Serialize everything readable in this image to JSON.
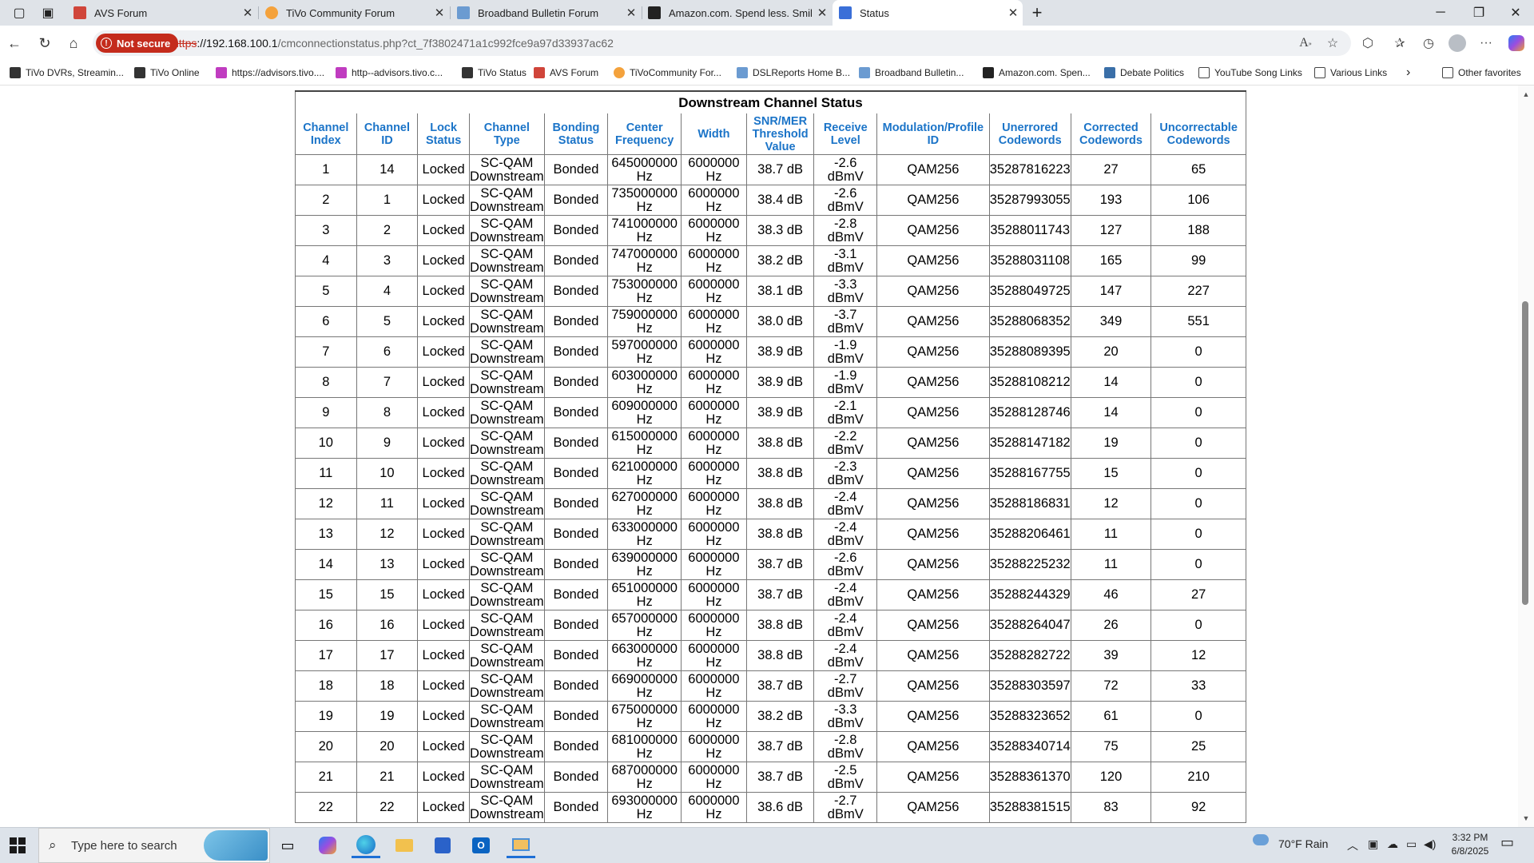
{
  "browser": {
    "tabs": [
      {
        "title": "AVS Forum",
        "favicon_color": "#d0453a",
        "active": false
      },
      {
        "title": "TiVo Community Forum",
        "favicon_color": "#f4a23c",
        "active": false
      },
      {
        "title": "Broadband Bulletin Forum",
        "favicon_color": "#6b9bd1",
        "active": false
      },
      {
        "title": "Amazon.com. Spend less. Smile more.",
        "favicon_color": "#222222",
        "active": false
      },
      {
        "title": "Status",
        "favicon_color": "#3a6fd8",
        "active": true
      }
    ],
    "close_glyph": "✕",
    "new_tab_glyph": "+",
    "window_controls": {
      "minimize": "─",
      "restore": "❐",
      "close": "✕"
    },
    "security_label": "Not secure",
    "url_protocol": "https",
    "url_host": "://192.168.100.1",
    "url_path": "/cmconnectionstatus.php?ct_7f3802471a1c992fce9a97d33937ac62",
    "bookmarks": [
      {
        "label": "TiVo DVRs, Streamin...",
        "icon": "tivo-icon"
      },
      {
        "label": "TiVo Online",
        "icon": "tivo-icon"
      },
      {
        "label": "https://advisors.tivo....",
        "icon": "bookmark-icon"
      },
      {
        "label": "http--advisors.tivo.c...",
        "icon": "bookmark-icon"
      },
      {
        "label": "TiVo Status",
        "icon": "tivo-icon"
      },
      {
        "label": "AVS Forum",
        "icon": "avs-icon"
      },
      {
        "label": "TiVoCommunity For...",
        "icon": "tivocommunity-icon"
      },
      {
        "label": "DSLReports Home B...",
        "icon": "dslreports-icon"
      },
      {
        "label": "Broadband Bulletin...",
        "icon": "broadband-icon"
      },
      {
        "label": "Amazon.com. Spen...",
        "icon": "amazon-icon"
      },
      {
        "label": "Debate Politics",
        "icon": "debate-icon"
      },
      {
        "label": "YouTube Song Links",
        "icon": "folder-icon"
      },
      {
        "label": "Various Links",
        "icon": "folder-icon"
      }
    ],
    "other_favorites": "Other favorites"
  },
  "table": {
    "title": "Downstream Channel Status",
    "headers": [
      [
        "Channel",
        "Index"
      ],
      [
        "Channel",
        "ID"
      ],
      [
        "Lock",
        "Status"
      ],
      [
        "Channel",
        "Type"
      ],
      [
        "Bonding",
        "Status"
      ],
      [
        "Center",
        "Frequency"
      ],
      [
        "Width"
      ],
      [
        "SNR/MER",
        "Threshold",
        "Value"
      ],
      [
        "Receive",
        "Level"
      ],
      [
        "Modulation/Profile",
        "ID"
      ],
      [
        "Unerrored",
        "Codewords"
      ],
      [
        "Corrected",
        "Codewords"
      ],
      [
        "Uncorrectable",
        "Codewords"
      ]
    ],
    "rows": [
      [
        "1",
        "14",
        "Locked",
        "SC-QAM Downstream",
        "Bonded",
        "645000000 Hz",
        "6000000 Hz",
        "38.7 dB",
        "-2.6 dBmV",
        "QAM256",
        "35287816223",
        "27",
        "65"
      ],
      [
        "2",
        "1",
        "Locked",
        "SC-QAM Downstream",
        "Bonded",
        "735000000 Hz",
        "6000000 Hz",
        "38.4 dB",
        "-2.6 dBmV",
        "QAM256",
        "35287993055",
        "193",
        "106"
      ],
      [
        "3",
        "2",
        "Locked",
        "SC-QAM Downstream",
        "Bonded",
        "741000000 Hz",
        "6000000 Hz",
        "38.3 dB",
        "-2.8 dBmV",
        "QAM256",
        "35288011743",
        "127",
        "188"
      ],
      [
        "4",
        "3",
        "Locked",
        "SC-QAM Downstream",
        "Bonded",
        "747000000 Hz",
        "6000000 Hz",
        "38.2 dB",
        "-3.1 dBmV",
        "QAM256",
        "35288031108",
        "165",
        "99"
      ],
      [
        "5",
        "4",
        "Locked",
        "SC-QAM Downstream",
        "Bonded",
        "753000000 Hz",
        "6000000 Hz",
        "38.1 dB",
        "-3.3 dBmV",
        "QAM256",
        "35288049725",
        "147",
        "227"
      ],
      [
        "6",
        "5",
        "Locked",
        "SC-QAM Downstream",
        "Bonded",
        "759000000 Hz",
        "6000000 Hz",
        "38.0 dB",
        "-3.7 dBmV",
        "QAM256",
        "35288068352",
        "349",
        "551"
      ],
      [
        "7",
        "6",
        "Locked",
        "SC-QAM Downstream",
        "Bonded",
        "597000000 Hz",
        "6000000 Hz",
        "38.9 dB",
        "-1.9 dBmV",
        "QAM256",
        "35288089395",
        "20",
        "0"
      ],
      [
        "8",
        "7",
        "Locked",
        "SC-QAM Downstream",
        "Bonded",
        "603000000 Hz",
        "6000000 Hz",
        "38.9 dB",
        "-1.9 dBmV",
        "QAM256",
        "35288108212",
        "14",
        "0"
      ],
      [
        "9",
        "8",
        "Locked",
        "SC-QAM Downstream",
        "Bonded",
        "609000000 Hz",
        "6000000 Hz",
        "38.9 dB",
        "-2.1 dBmV",
        "QAM256",
        "35288128746",
        "14",
        "0"
      ],
      [
        "10",
        "9",
        "Locked",
        "SC-QAM Downstream",
        "Bonded",
        "615000000 Hz",
        "6000000 Hz",
        "38.8 dB",
        "-2.2 dBmV",
        "QAM256",
        "35288147182",
        "19",
        "0"
      ],
      [
        "11",
        "10",
        "Locked",
        "SC-QAM Downstream",
        "Bonded",
        "621000000 Hz",
        "6000000 Hz",
        "38.8 dB",
        "-2.3 dBmV",
        "QAM256",
        "35288167755",
        "15",
        "0"
      ],
      [
        "12",
        "11",
        "Locked",
        "SC-QAM Downstream",
        "Bonded",
        "627000000 Hz",
        "6000000 Hz",
        "38.8 dB",
        "-2.4 dBmV",
        "QAM256",
        "35288186831",
        "12",
        "0"
      ],
      [
        "13",
        "12",
        "Locked",
        "SC-QAM Downstream",
        "Bonded",
        "633000000 Hz",
        "6000000 Hz",
        "38.8 dB",
        "-2.4 dBmV",
        "QAM256",
        "35288206461",
        "11",
        "0"
      ],
      [
        "14",
        "13",
        "Locked",
        "SC-QAM Downstream",
        "Bonded",
        "639000000 Hz",
        "6000000 Hz",
        "38.7 dB",
        "-2.6 dBmV",
        "QAM256",
        "35288225232",
        "11",
        "0"
      ],
      [
        "15",
        "15",
        "Locked",
        "SC-QAM Downstream",
        "Bonded",
        "651000000 Hz",
        "6000000 Hz",
        "38.7 dB",
        "-2.4 dBmV",
        "QAM256",
        "35288244329",
        "46",
        "27"
      ],
      [
        "16",
        "16",
        "Locked",
        "SC-QAM Downstream",
        "Bonded",
        "657000000 Hz",
        "6000000 Hz",
        "38.8 dB",
        "-2.4 dBmV",
        "QAM256",
        "35288264047",
        "26",
        "0"
      ],
      [
        "17",
        "17",
        "Locked",
        "SC-QAM Downstream",
        "Bonded",
        "663000000 Hz",
        "6000000 Hz",
        "38.8 dB",
        "-2.4 dBmV",
        "QAM256",
        "35288282722",
        "39",
        "12"
      ],
      [
        "18",
        "18",
        "Locked",
        "SC-QAM Downstream",
        "Bonded",
        "669000000 Hz",
        "6000000 Hz",
        "38.7 dB",
        "-2.7 dBmV",
        "QAM256",
        "35288303597",
        "72",
        "33"
      ],
      [
        "19",
        "19",
        "Locked",
        "SC-QAM Downstream",
        "Bonded",
        "675000000 Hz",
        "6000000 Hz",
        "38.2 dB",
        "-3.3 dBmV",
        "QAM256",
        "35288323652",
        "61",
        "0"
      ],
      [
        "20",
        "20",
        "Locked",
        "SC-QAM Downstream",
        "Bonded",
        "681000000 Hz",
        "6000000 Hz",
        "38.7 dB",
        "-2.8 dBmV",
        "QAM256",
        "35288340714",
        "75",
        "25"
      ],
      [
        "21",
        "21",
        "Locked",
        "SC-QAM Downstream",
        "Bonded",
        "687000000 Hz",
        "6000000 Hz",
        "38.7 dB",
        "-2.5 dBmV",
        "QAM256",
        "35288361370",
        "120",
        "210"
      ],
      [
        "22",
        "22",
        "Locked",
        "SC-QAM Downstream",
        "Bonded",
        "693000000 Hz",
        "6000000 Hz",
        "38.6 dB",
        "-2.7 dBmV",
        "QAM256",
        "35288381515",
        "83",
        "92"
      ]
    ]
  },
  "taskbar": {
    "search_placeholder": "Type here to search",
    "weather": "70°F  Rain",
    "time": "3:32 PM",
    "date": "6/8/2025"
  }
}
